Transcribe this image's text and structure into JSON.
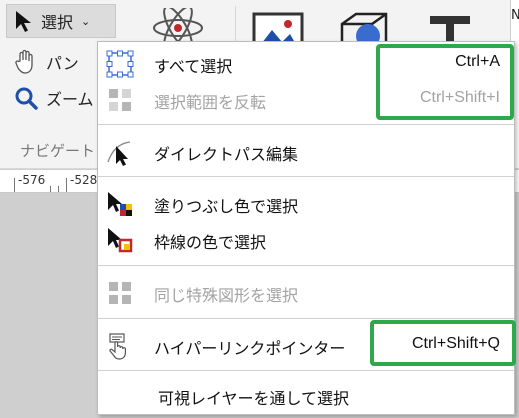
{
  "ribbon": {
    "select_label": "選択",
    "pan_label": "パン",
    "zoom_label": "ズーム",
    "group_label": "ナビゲート",
    "edge_letter": "N"
  },
  "ruler": {
    "labels": [
      "-576",
      "-528"
    ]
  },
  "menu": {
    "items": [
      {
        "label": "すべて選択",
        "shortcut": "Ctrl+A",
        "enabled": true,
        "icon": "select-all-icon"
      },
      {
        "label": "選択範囲を反転",
        "shortcut": "Ctrl+Shift+I",
        "enabled": false,
        "icon": "invert-selection-icon"
      },
      {
        "label": "ダイレクトパス編集",
        "shortcut": "",
        "enabled": true,
        "icon": "direct-path-edit-icon"
      },
      {
        "label": "塗りつぶし色で選択",
        "shortcut": "",
        "enabled": true,
        "icon": "select-by-fill-color-icon"
      },
      {
        "label": "枠線の色で選択",
        "shortcut": "",
        "enabled": true,
        "icon": "select-by-stroke-color-icon"
      },
      {
        "label": "同じ特殊図形を選択",
        "shortcut": "",
        "enabled": false,
        "icon": "select-same-shape-icon"
      },
      {
        "label": "ハイパーリンクポインター",
        "shortcut": "Ctrl+Shift+Q",
        "enabled": true,
        "icon": "hyperlink-pointer-icon"
      },
      {
        "label": "可視レイヤーを通して選択",
        "shortcut": "",
        "enabled": true,
        "icon": ""
      }
    ]
  },
  "colors": {
    "highlight": "#2da84a",
    "disabled_text": "#a3a3a3",
    "menu_bg": "#ffffff",
    "canvas_bg": "#cfcfcf"
  }
}
